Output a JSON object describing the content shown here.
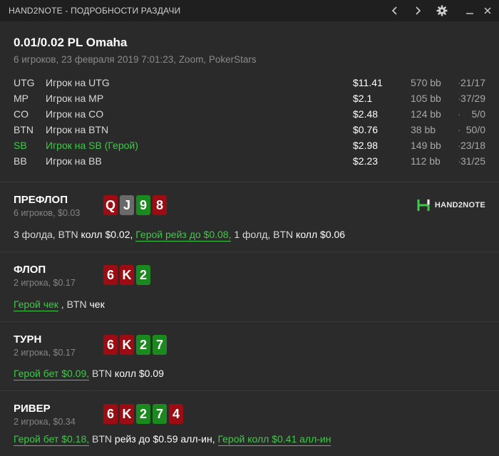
{
  "window": {
    "title": "HAND2NOTE - ПОДРОБНОСТИ РАЗДАЧИ",
    "icons": [
      "chevron-left-icon",
      "chevron-right-icon",
      "gear-icon",
      "minimize-icon",
      "close-icon"
    ]
  },
  "hand": {
    "title": "0.01/0.02 PL Omaha",
    "subtitle": "6 игроков, 23 февраля 2019 7:01:23, Zoom, PokerStars"
  },
  "players": [
    {
      "pos": "UTG",
      "name": "Игрок на UTG",
      "stack": "$11.41",
      "bb": "570 bb",
      "sep": "·",
      "stat": "21/17",
      "hero": false
    },
    {
      "pos": "MP",
      "name": "Игрок на MP",
      "stack": "$2.1",
      "bb": "105 bb",
      "sep": "·",
      "stat": "37/29",
      "hero": false
    },
    {
      "pos": "CO",
      "name": "Игрок на CO",
      "stack": "$2.48",
      "bb": "124 bb",
      "sep": "·",
      "stat": "5/0",
      "hero": false
    },
    {
      "pos": "BTN",
      "name": "Игрок на BTN",
      "stack": "$0.76",
      "bb": "38 bb",
      "sep": "·",
      "stat": "50/0",
      "hero": false
    },
    {
      "pos": "SB",
      "name": "Игрок на SB (Герой)",
      "stack": "$2.98",
      "bb": "149 bb",
      "sep": "·",
      "stat": "23/18",
      "hero": true
    },
    {
      "pos": "BB",
      "name": "Игрок на BB",
      "stack": "$2.23",
      "bb": "112 bb",
      "sep": "·",
      "stat": "31/25",
      "hero": false
    }
  ],
  "colors": {
    "red": "#9b0d12",
    "green": "#1a8a1e",
    "gray": "#6a6a6a",
    "hero_green": "#3ec948"
  },
  "logo_text": "HAND2NOTE",
  "streets": {
    "preflop": {
      "name": "ПРЕФЛОП",
      "sub": "6 игроков, $0.03",
      "cards": [
        {
          "r": "Q",
          "c": "red"
        },
        {
          "r": "J",
          "c": "gray"
        },
        {
          "r": "9",
          "c": "green"
        },
        {
          "r": "8",
          "c": "red"
        }
      ],
      "actions": {
        "a1": "3 фолда, BTN ",
        "a2": "колл $0.02,",
        "a3": "Герой рейз до $0.08,",
        "a4": " 1 фолд, BTN ",
        "a5": "колл $0.06"
      }
    },
    "flop": {
      "name": "ФЛОП",
      "sub": "2 игрока, $0.17",
      "cards": [
        {
          "r": "6",
          "c": "red"
        },
        {
          "r": "K",
          "c": "red"
        },
        {
          "r": "2",
          "c": "green"
        }
      ],
      "actions": {
        "a1": "Герой чек",
        "a2": " , BTN ",
        "a3": "чек"
      }
    },
    "turn": {
      "name": "ТУРН",
      "sub": "2 игрока, $0.17",
      "cards": [
        {
          "r": "6",
          "c": "red"
        },
        {
          "r": "K",
          "c": "red"
        },
        {
          "r": "2",
          "c": "green"
        },
        {
          "r": "7",
          "c": "green"
        }
      ],
      "actions": {
        "a1": "Герой бет $0.09,",
        "a2": " BTN ",
        "a3": "колл $0.09"
      }
    },
    "river": {
      "name": "РИВЕР",
      "sub": "2 игрока, $0.34",
      "cards": [
        {
          "r": "6",
          "c": "red"
        },
        {
          "r": "K",
          "c": "red"
        },
        {
          "r": "2",
          "c": "green"
        },
        {
          "r": "7",
          "c": "green"
        },
        {
          "r": "4",
          "c": "red"
        }
      ],
      "actions": {
        "a1": "Герой бет $0.18,",
        "a2": " BTN ",
        "a3": "рейз до $0.59 алл-ин,",
        "a4": "Герой колл $0.41 алл-ин"
      }
    }
  }
}
